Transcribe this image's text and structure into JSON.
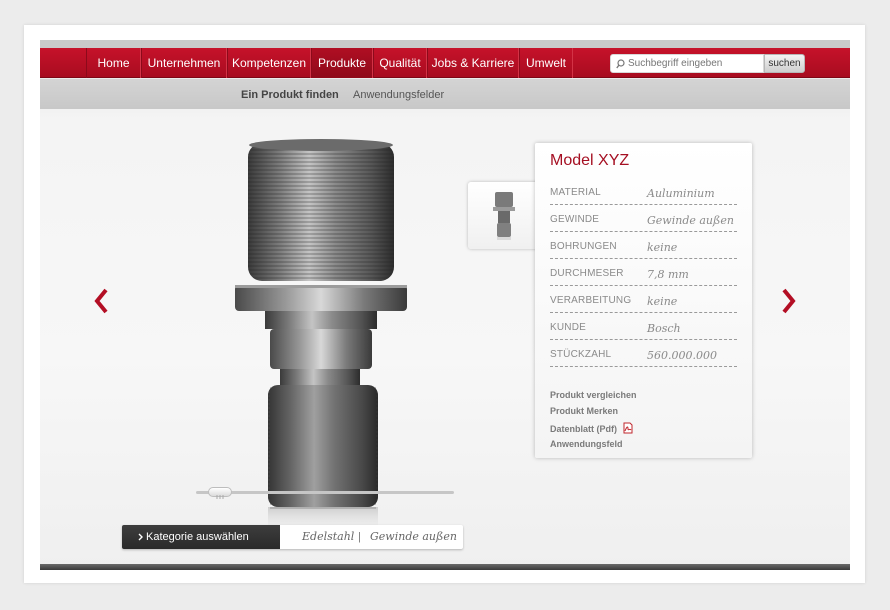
{
  "nav": {
    "items": [
      {
        "label": "Home"
      },
      {
        "label": "Unternehmen"
      },
      {
        "label": "Kompetenzen"
      },
      {
        "label": "Produkte"
      },
      {
        "label": "Qualität"
      },
      {
        "label": "Jobs & Karriere"
      },
      {
        "label": "Umwelt"
      }
    ],
    "active": "Produkte"
  },
  "search": {
    "placeholder": "Suchbegriff eingeben",
    "button_label": "suchen"
  },
  "subnav": {
    "items": [
      {
        "label": "Ein Produkt finden"
      },
      {
        "label": "Anwendungsfelder"
      }
    ]
  },
  "product": {
    "title": "Model XYZ",
    "specs": [
      {
        "label": "MATERIAL",
        "value": "Auluminium"
      },
      {
        "label": "GEWINDE",
        "value": "Gewinde außen"
      },
      {
        "label": "BOHRUNGEN",
        "value": "keine"
      },
      {
        "label": "DURCHMESER",
        "value": "7,8 mm"
      },
      {
        "label": "VERARBEITUNG",
        "value": "keine"
      },
      {
        "label": "KUNDE",
        "value": "Bosch"
      },
      {
        "label": "STÜCKZAHL",
        "value": "560.000.000"
      }
    ],
    "actions": [
      {
        "label": "Produkt vergleichen"
      },
      {
        "label": "Produkt Merken"
      },
      {
        "label": "Datenblatt (Pdf)"
      },
      {
        "label": "Anwendungsfeld"
      }
    ]
  },
  "category": {
    "button_label": "Kategorie auswählen",
    "tags": [
      "Edelstahl",
      "Gewinde außen"
    ],
    "separator": "|"
  },
  "icons": {
    "prev": "chevron-left-icon",
    "next": "chevron-right-icon",
    "search": "search-icon",
    "pdf": "pdf-icon",
    "category": "chevron-right-small-icon"
  },
  "colors": {
    "brand": "#b30e24",
    "accent": "#a50f22"
  }
}
